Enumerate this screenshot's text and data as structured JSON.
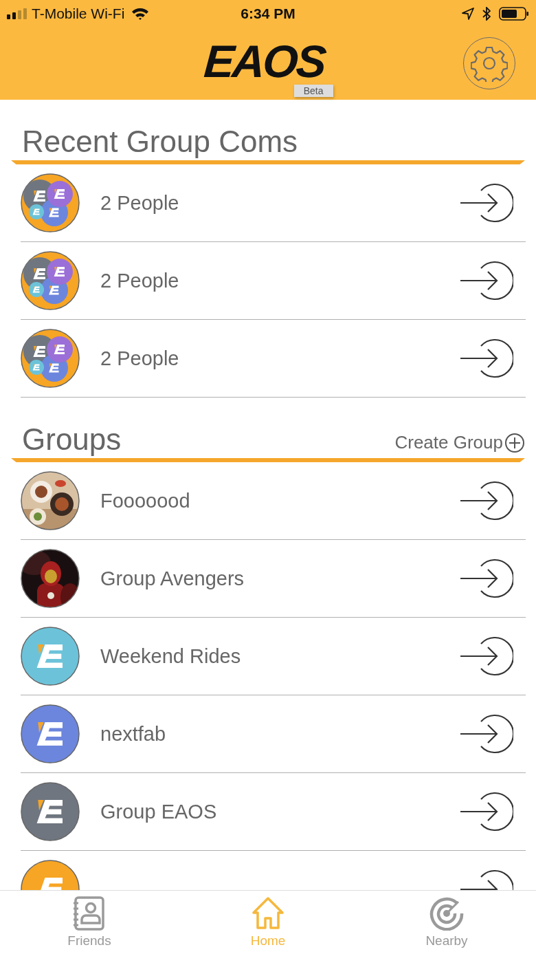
{
  "status_bar": {
    "carrier": "T-Mobile Wi-Fi",
    "time": "6:34 PM"
  },
  "header": {
    "logo": "EAOS",
    "badge": "Beta"
  },
  "recent": {
    "title": "Recent Group Coms",
    "items": [
      {
        "label": "2 People",
        "avatar": {
          "kind": "group"
        }
      },
      {
        "label": "2 People",
        "avatar": {
          "kind": "group"
        }
      },
      {
        "label": "2 People",
        "avatar": {
          "kind": "group"
        }
      }
    ]
  },
  "groups": {
    "title": "Groups",
    "action": "Create Group",
    "items": [
      {
        "label": "Fooooood"
      },
      {
        "label": "Group Avengers"
      },
      {
        "label": "Weekend Rides",
        "avatar": {
          "kind": "logo",
          "color": "#6cc3d9"
        }
      },
      {
        "label": "nextfab",
        "avatar": {
          "kind": "logo",
          "color": "#6c86dd"
        }
      },
      {
        "label": "Group EAOS",
        "avatar": {
          "kind": "logo",
          "color": "#6f7680"
        }
      },
      {
        "avatar": {
          "kind": "logo",
          "color": "#f7a524"
        }
      }
    ]
  },
  "tabs": [
    {
      "label": "Friends",
      "selected": false
    },
    {
      "label": "Home",
      "selected": true
    },
    {
      "label": "Nearby",
      "selected": false
    }
  ]
}
